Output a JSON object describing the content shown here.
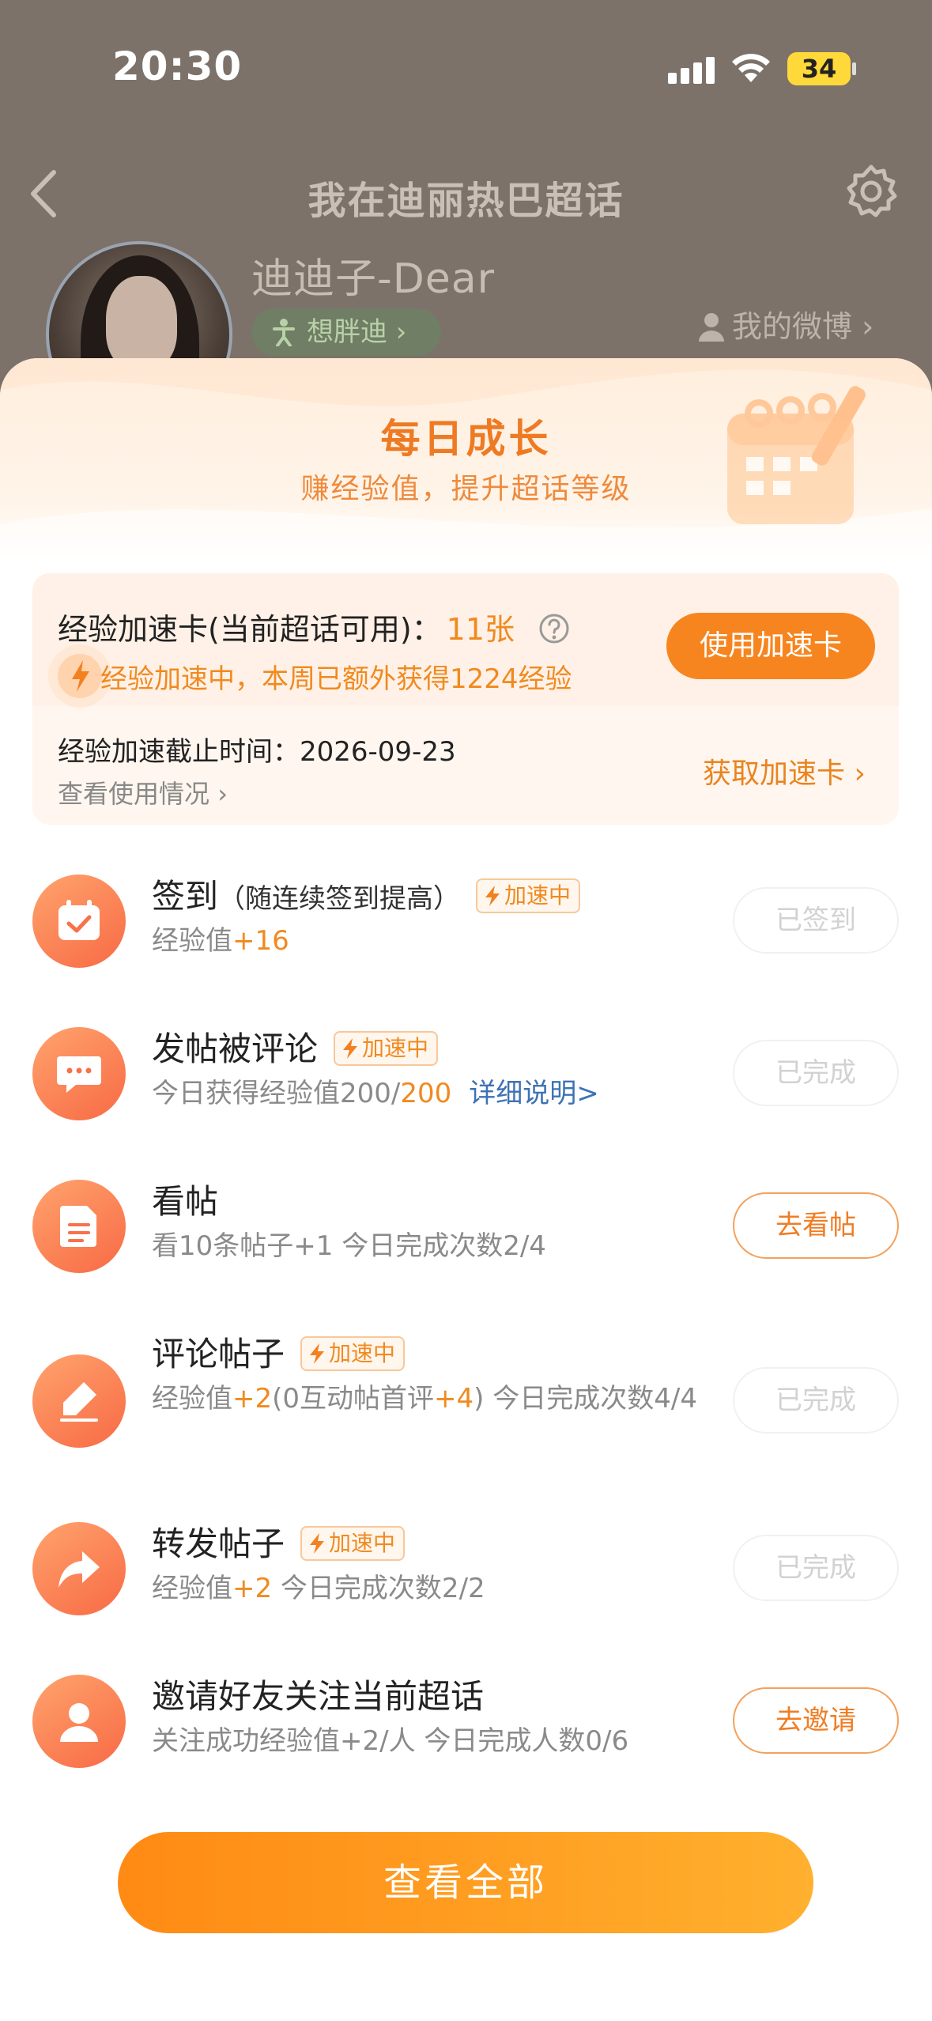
{
  "status_bar": {
    "time": "20:30",
    "battery": "34"
  },
  "nav": {
    "title": "我在迪丽热巴超话"
  },
  "profile": {
    "username": "迪迪子-Dear",
    "tag": "想胖迪",
    "my_weibo": "我的微博"
  },
  "sheet": {
    "title": "每日成长",
    "subtitle": "赚经验值，提升超话等级"
  },
  "boost_card": {
    "title": "经验加速卡(当前超话可用)：",
    "count": "11张",
    "status": "经验加速中，本周已额外获得1224经验",
    "button": "使用加速卡",
    "deadline": "经验加速截止时间：2026-09-23",
    "usage_link": "查看使用情况",
    "get_link": "获取加速卡"
  },
  "badge_label": "加速中",
  "tasks": [
    {
      "title": "签到",
      "note": "（随连续签到提高）",
      "boosted": true,
      "desc_prefix": "经验值",
      "desc_hl": "+16",
      "button": "已签到",
      "done": true,
      "icon": "calendar-check-icon"
    },
    {
      "title": "发帖被评论",
      "boosted": true,
      "desc_prefix": "今日获得经验值200/",
      "desc_hl": "200",
      "desc_link": "详细说明>",
      "button": "已完成",
      "done": true,
      "icon": "comment-bubble-icon"
    },
    {
      "title": "看帖",
      "boosted": false,
      "desc_prefix": "看10条帖子+1   今日完成次数2/4",
      "button": "去看帖",
      "done": false,
      "icon": "document-icon"
    },
    {
      "title": "评论帖子",
      "boosted": true,
      "desc_a": "经验值",
      "desc_hl_a": "+2",
      "desc_b": "(0互动帖首评",
      "desc_hl_b": "+4",
      "desc_c": ")   今日完成次数4/4",
      "button": "已完成",
      "done": true,
      "icon": "pencil-icon"
    },
    {
      "title": "转发帖子",
      "boosted": true,
      "desc_prefix": "经验值",
      "desc_hl": "+2",
      "desc_suffix": "   今日完成次数2/2",
      "button": "已完成",
      "done": true,
      "icon": "share-arrow-icon"
    },
    {
      "title": "邀请好友关注当前超话",
      "boosted": false,
      "desc_prefix": "关注成功经验值+2/人   今日完成人数0/6",
      "button": "去邀请",
      "done": false,
      "icon": "user-icon"
    }
  ],
  "view_all": "查看全部",
  "colors": {
    "accent": "#f7851f",
    "link": "#3e72b3",
    "muted": "#8a8a8a"
  }
}
